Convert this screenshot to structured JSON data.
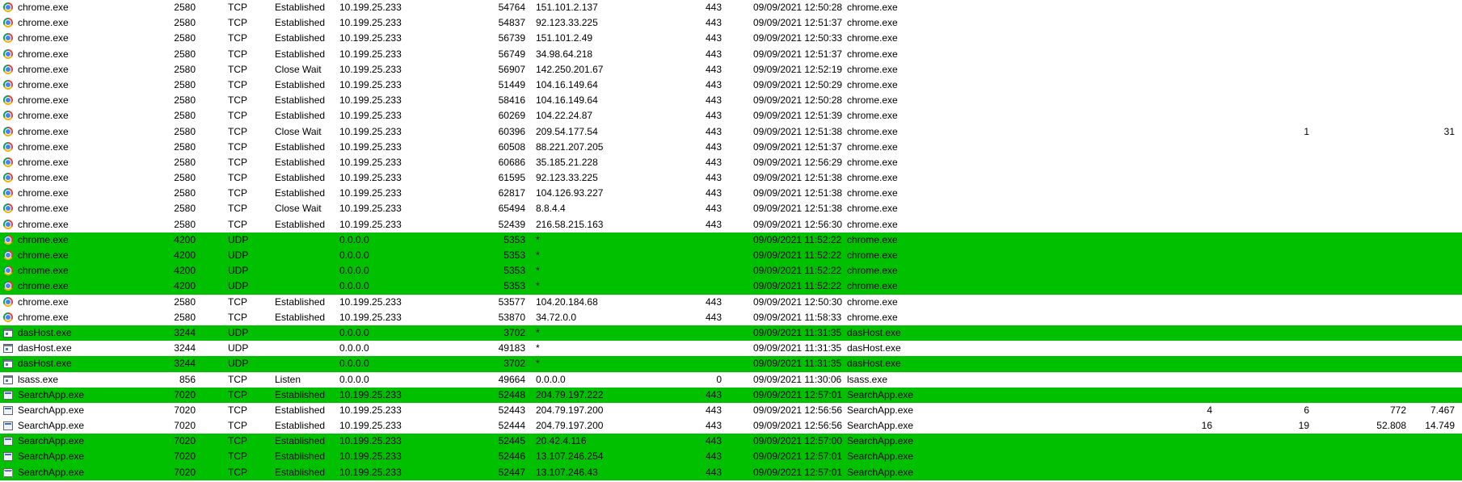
{
  "colors": {
    "highlight": "#00c000",
    "normal": "#ffffff"
  },
  "rows": [
    {
      "icon": "chrome-icon",
      "process": "chrome.exe",
      "pid": "2580",
      "protocol": "TCP",
      "state": "Established",
      "local_address": "10.199.25.233",
      "local_port": "54764",
      "remote_address": "151.101.2.137",
      "remote_port": "443",
      "create_time": "09/09/2021 12:50:28",
      "module": "chrome.exe",
      "sent_packets": "",
      "received_packets": "",
      "sent_bytes": "",
      "received_bytes": "",
      "highlight": false
    },
    {
      "icon": "chrome-icon",
      "process": "chrome.exe",
      "pid": "2580",
      "protocol": "TCP",
      "state": "Established",
      "local_address": "10.199.25.233",
      "local_port": "54837",
      "remote_address": "92.123.33.225",
      "remote_port": "443",
      "create_time": "09/09/2021 12:51:37",
      "module": "chrome.exe",
      "sent_packets": "",
      "received_packets": "",
      "sent_bytes": "",
      "received_bytes": "",
      "highlight": false
    },
    {
      "icon": "chrome-icon",
      "process": "chrome.exe",
      "pid": "2580",
      "protocol": "TCP",
      "state": "Established",
      "local_address": "10.199.25.233",
      "local_port": "56739",
      "remote_address": "151.101.2.49",
      "remote_port": "443",
      "create_time": "09/09/2021 12:50:33",
      "module": "chrome.exe",
      "sent_packets": "",
      "received_packets": "",
      "sent_bytes": "",
      "received_bytes": "",
      "highlight": false
    },
    {
      "icon": "chrome-icon",
      "process": "chrome.exe",
      "pid": "2580",
      "protocol": "TCP",
      "state": "Established",
      "local_address": "10.199.25.233",
      "local_port": "56749",
      "remote_address": "34.98.64.218",
      "remote_port": "443",
      "create_time": "09/09/2021 12:51:37",
      "module": "chrome.exe",
      "sent_packets": "",
      "received_packets": "",
      "sent_bytes": "",
      "received_bytes": "",
      "highlight": false
    },
    {
      "icon": "chrome-icon",
      "process": "chrome.exe",
      "pid": "2580",
      "protocol": "TCP",
      "state": "Close Wait",
      "local_address": "10.199.25.233",
      "local_port": "56907",
      "remote_address": "142.250.201.67",
      "remote_port": "443",
      "create_time": "09/09/2021 12:52:19",
      "module": "chrome.exe",
      "sent_packets": "",
      "received_packets": "",
      "sent_bytes": "",
      "received_bytes": "",
      "highlight": false
    },
    {
      "icon": "chrome-icon",
      "process": "chrome.exe",
      "pid": "2580",
      "protocol": "TCP",
      "state": "Established",
      "local_address": "10.199.25.233",
      "local_port": "51449",
      "remote_address": "104.16.149.64",
      "remote_port": "443",
      "create_time": "09/09/2021 12:50:29",
      "module": "chrome.exe",
      "sent_packets": "",
      "received_packets": "",
      "sent_bytes": "",
      "received_bytes": "",
      "highlight": false
    },
    {
      "icon": "chrome-icon",
      "process": "chrome.exe",
      "pid": "2580",
      "protocol": "TCP",
      "state": "Established",
      "local_address": "10.199.25.233",
      "local_port": "58416",
      "remote_address": "104.16.149.64",
      "remote_port": "443",
      "create_time": "09/09/2021 12:50:28",
      "module": "chrome.exe",
      "sent_packets": "",
      "received_packets": "",
      "sent_bytes": "",
      "received_bytes": "",
      "highlight": false
    },
    {
      "icon": "chrome-icon",
      "process": "chrome.exe",
      "pid": "2580",
      "protocol": "TCP",
      "state": "Established",
      "local_address": "10.199.25.233",
      "local_port": "60269",
      "remote_address": "104.22.24.87",
      "remote_port": "443",
      "create_time": "09/09/2021 12:51:39",
      "module": "chrome.exe",
      "sent_packets": "",
      "received_packets": "",
      "sent_bytes": "",
      "received_bytes": "",
      "highlight": false
    },
    {
      "icon": "chrome-icon",
      "process": "chrome.exe",
      "pid": "2580",
      "protocol": "TCP",
      "state": "Close Wait",
      "local_address": "10.199.25.233",
      "local_port": "60396",
      "remote_address": "209.54.177.54",
      "remote_port": "443",
      "create_time": "09/09/2021 12:51:38",
      "module": "chrome.exe",
      "sent_packets": "",
      "received_packets": "1",
      "sent_bytes": "",
      "received_bytes": "31",
      "highlight": false
    },
    {
      "icon": "chrome-icon",
      "process": "chrome.exe",
      "pid": "2580",
      "protocol": "TCP",
      "state": "Established",
      "local_address": "10.199.25.233",
      "local_port": "60508",
      "remote_address": "88.221.207.205",
      "remote_port": "443",
      "create_time": "09/09/2021 12:51:37",
      "module": "chrome.exe",
      "sent_packets": "",
      "received_packets": "",
      "sent_bytes": "",
      "received_bytes": "",
      "highlight": false
    },
    {
      "icon": "chrome-icon",
      "process": "chrome.exe",
      "pid": "2580",
      "protocol": "TCP",
      "state": "Established",
      "local_address": "10.199.25.233",
      "local_port": "60686",
      "remote_address": "35.185.21.228",
      "remote_port": "443",
      "create_time": "09/09/2021 12:56:29",
      "module": "chrome.exe",
      "sent_packets": "",
      "received_packets": "",
      "sent_bytes": "",
      "received_bytes": "",
      "highlight": false
    },
    {
      "icon": "chrome-icon",
      "process": "chrome.exe",
      "pid": "2580",
      "protocol": "TCP",
      "state": "Established",
      "local_address": "10.199.25.233",
      "local_port": "61595",
      "remote_address": "92.123.33.225",
      "remote_port": "443",
      "create_time": "09/09/2021 12:51:38",
      "module": "chrome.exe",
      "sent_packets": "",
      "received_packets": "",
      "sent_bytes": "",
      "received_bytes": "",
      "highlight": false
    },
    {
      "icon": "chrome-icon",
      "process": "chrome.exe",
      "pid": "2580",
      "protocol": "TCP",
      "state": "Established",
      "local_address": "10.199.25.233",
      "local_port": "62817",
      "remote_address": "104.126.93.227",
      "remote_port": "443",
      "create_time": "09/09/2021 12:51:38",
      "module": "chrome.exe",
      "sent_packets": "",
      "received_packets": "",
      "sent_bytes": "",
      "received_bytes": "",
      "highlight": false
    },
    {
      "icon": "chrome-icon",
      "process": "chrome.exe",
      "pid": "2580",
      "protocol": "TCP",
      "state": "Close Wait",
      "local_address": "10.199.25.233",
      "local_port": "65494",
      "remote_address": "8.8.4.4",
      "remote_port": "443",
      "create_time": "09/09/2021 12:51:38",
      "module": "chrome.exe",
      "sent_packets": "",
      "received_packets": "",
      "sent_bytes": "",
      "received_bytes": "",
      "highlight": false
    },
    {
      "icon": "chrome-icon",
      "process": "chrome.exe",
      "pid": "2580",
      "protocol": "TCP",
      "state": "Established",
      "local_address": "10.199.25.233",
      "local_port": "52439",
      "remote_address": "216.58.215.163",
      "remote_port": "443",
      "create_time": "09/09/2021 12:56:30",
      "module": "chrome.exe",
      "sent_packets": "",
      "received_packets": "",
      "sent_bytes": "",
      "received_bytes": "",
      "highlight": false
    },
    {
      "icon": "chrome-icon",
      "process": "chrome.exe",
      "pid": "4200",
      "protocol": "UDP",
      "state": "",
      "local_address": "0.0.0.0",
      "local_port": "5353",
      "remote_address": "*",
      "remote_port": "",
      "create_time": "09/09/2021 11:52:22",
      "module": "chrome.exe",
      "sent_packets": "",
      "received_packets": "",
      "sent_bytes": "",
      "received_bytes": "",
      "highlight": true
    },
    {
      "icon": "chrome-icon",
      "process": "chrome.exe",
      "pid": "4200",
      "protocol": "UDP",
      "state": "",
      "local_address": "0.0.0.0",
      "local_port": "5353",
      "remote_address": "*",
      "remote_port": "",
      "create_time": "09/09/2021 11:52:22",
      "module": "chrome.exe",
      "sent_packets": "",
      "received_packets": "",
      "sent_bytes": "",
      "received_bytes": "",
      "highlight": true
    },
    {
      "icon": "chrome-icon",
      "process": "chrome.exe",
      "pid": "4200",
      "protocol": "UDP",
      "state": "",
      "local_address": "0.0.0.0",
      "local_port": "5353",
      "remote_address": "*",
      "remote_port": "",
      "create_time": "09/09/2021 11:52:22",
      "module": "chrome.exe",
      "sent_packets": "",
      "received_packets": "",
      "sent_bytes": "",
      "received_bytes": "",
      "highlight": true
    },
    {
      "icon": "chrome-icon",
      "process": "chrome.exe",
      "pid": "4200",
      "protocol": "UDP",
      "state": "",
      "local_address": "0.0.0.0",
      "local_port": "5353",
      "remote_address": "*",
      "remote_port": "",
      "create_time": "09/09/2021 11:52:22",
      "module": "chrome.exe",
      "sent_packets": "",
      "received_packets": "",
      "sent_bytes": "",
      "received_bytes": "",
      "highlight": true
    },
    {
      "icon": "chrome-icon",
      "process": "chrome.exe",
      "pid": "2580",
      "protocol": "TCP",
      "state": "Established",
      "local_address": "10.199.25.233",
      "local_port": "53577",
      "remote_address": "104.20.184.68",
      "remote_port": "443",
      "create_time": "09/09/2021 12:50:30",
      "module": "chrome.exe",
      "sent_packets": "",
      "received_packets": "",
      "sent_bytes": "",
      "received_bytes": "",
      "highlight": false
    },
    {
      "icon": "chrome-icon",
      "process": "chrome.exe",
      "pid": "2580",
      "protocol": "TCP",
      "state": "Established",
      "local_address": "10.199.25.233",
      "local_port": "53870",
      "remote_address": "34.72.0.0",
      "remote_port": "443",
      "create_time": "09/09/2021 11:58:33",
      "module": "chrome.exe",
      "sent_packets": "",
      "received_packets": "",
      "sent_bytes": "",
      "received_bytes": "",
      "highlight": false
    },
    {
      "icon": "window-icon",
      "process": "dasHost.exe",
      "pid": "3244",
      "protocol": "UDP",
      "state": "",
      "local_address": "0.0.0.0",
      "local_port": "3702",
      "remote_address": "*",
      "remote_port": "",
      "create_time": "09/09/2021 11:31:35",
      "module": "dasHost.exe",
      "sent_packets": "",
      "received_packets": "",
      "sent_bytes": "",
      "received_bytes": "",
      "highlight": true
    },
    {
      "icon": "window-icon",
      "process": "dasHost.exe",
      "pid": "3244",
      "protocol": "UDP",
      "state": "",
      "local_address": "0.0.0.0",
      "local_port": "49183",
      "remote_address": "*",
      "remote_port": "",
      "create_time": "09/09/2021 11:31:35",
      "module": "dasHost.exe",
      "sent_packets": "",
      "received_packets": "",
      "sent_bytes": "",
      "received_bytes": "",
      "highlight": false
    },
    {
      "icon": "window-icon",
      "process": "dasHost.exe",
      "pid": "3244",
      "protocol": "UDP",
      "state": "",
      "local_address": "0.0.0.0",
      "local_port": "3702",
      "remote_address": "*",
      "remote_port": "",
      "create_time": "09/09/2021 11:31:35",
      "module": "dasHost.exe",
      "sent_packets": "",
      "received_packets": "",
      "sent_bytes": "",
      "received_bytes": "",
      "highlight": true
    },
    {
      "icon": "window-icon",
      "process": "lsass.exe",
      "pid": "856",
      "protocol": "TCP",
      "state": "Listen",
      "local_address": "0.0.0.0",
      "local_port": "49664",
      "remote_address": "0.0.0.0",
      "remote_port": "0",
      "create_time": "09/09/2021 11:30:06",
      "module": "lsass.exe",
      "sent_packets": "",
      "received_packets": "",
      "sent_bytes": "",
      "received_bytes": "",
      "highlight": false
    },
    {
      "icon": "app-icon",
      "process": "SearchApp.exe",
      "pid": "7020",
      "protocol": "TCP",
      "state": "Established",
      "local_address": "10.199.25.233",
      "local_port": "52448",
      "remote_address": "204.79.197.222",
      "remote_port": "443",
      "create_time": "09/09/2021 12:57:01",
      "module": "SearchApp.exe",
      "sent_packets": "",
      "received_packets": "",
      "sent_bytes": "",
      "received_bytes": "",
      "highlight": true
    },
    {
      "icon": "app-icon",
      "process": "SearchApp.exe",
      "pid": "7020",
      "protocol": "TCP",
      "state": "Established",
      "local_address": "10.199.25.233",
      "local_port": "52443",
      "remote_address": "204.79.197.200",
      "remote_port": "443",
      "create_time": "09/09/2021 12:56:56",
      "module": "SearchApp.exe",
      "sent_packets": "4",
      "received_packets": "6",
      "sent_bytes": "772",
      "received_bytes": "7.467",
      "highlight": false
    },
    {
      "icon": "app-icon",
      "process": "SearchApp.exe",
      "pid": "7020",
      "protocol": "TCP",
      "state": "Established",
      "local_address": "10.199.25.233",
      "local_port": "52444",
      "remote_address": "204.79.197.200",
      "remote_port": "443",
      "create_time": "09/09/2021 12:56:56",
      "module": "SearchApp.exe",
      "sent_packets": "16",
      "received_packets": "19",
      "sent_bytes": "52.808",
      "received_bytes": "14.749",
      "highlight": false
    },
    {
      "icon": "app-icon",
      "process": "SearchApp.exe",
      "pid": "7020",
      "protocol": "TCP",
      "state": "Established",
      "local_address": "10.199.25.233",
      "local_port": "52445",
      "remote_address": "20.42.4.116",
      "remote_port": "443",
      "create_time": "09/09/2021 12:57:00",
      "module": "SearchApp.exe",
      "sent_packets": "",
      "received_packets": "",
      "sent_bytes": "",
      "received_bytes": "",
      "highlight": true
    },
    {
      "icon": "app-icon",
      "process": "SearchApp.exe",
      "pid": "7020",
      "protocol": "TCP",
      "state": "Established",
      "local_address": "10.199.25.233",
      "local_port": "52446",
      "remote_address": "13.107.246.254",
      "remote_port": "443",
      "create_time": "09/09/2021 12:57:01",
      "module": "SearchApp.exe",
      "sent_packets": "",
      "received_packets": "",
      "sent_bytes": "",
      "received_bytes": "",
      "highlight": true
    },
    {
      "icon": "app-icon",
      "process": "SearchApp.exe",
      "pid": "7020",
      "protocol": "TCP",
      "state": "Established",
      "local_address": "10.199.25.233",
      "local_port": "52447",
      "remote_address": "13.107.246.43",
      "remote_port": "443",
      "create_time": "09/09/2021 12:57:01",
      "module": "SearchApp.exe",
      "sent_packets": "",
      "received_packets": "",
      "sent_bytes": "",
      "received_bytes": "",
      "highlight": true
    }
  ]
}
